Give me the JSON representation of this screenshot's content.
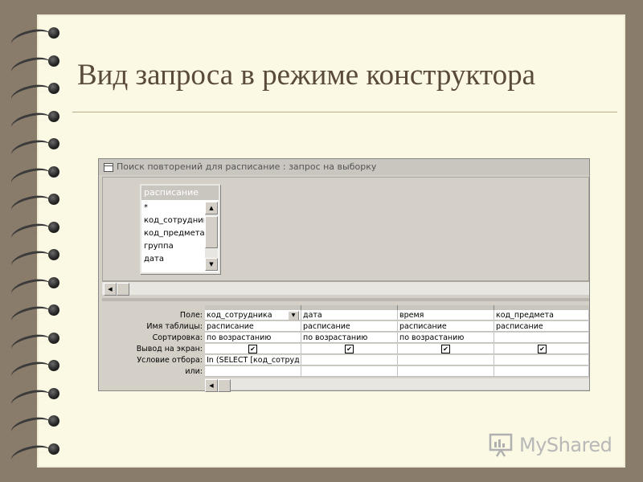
{
  "slide": {
    "title": "Вид запроса в режиме конструктора"
  },
  "window": {
    "title": "Поиск повторений для расписание : запрос на выборку"
  },
  "field_list": {
    "table_name": "расписание",
    "items": [
      "*",
      "код_сотрудник",
      "код_предмета",
      "группа",
      "дата"
    ]
  },
  "grid": {
    "row_labels": {
      "field": "Поле:",
      "table": "Имя таблицы:",
      "sort": "Сортировка:",
      "show": "Вывод на экран:",
      "criteria": "Условие отбора:",
      "or": "или:"
    },
    "columns": [
      {
        "field": "код_сотрудника",
        "table": "расписание",
        "sort": "по возрастанию",
        "show": true,
        "criteria": "In (SELECT [код_сотруд",
        "or": ""
      },
      {
        "field": "дата",
        "table": "расписание",
        "sort": "по возрастанию",
        "show": true,
        "criteria": "",
        "or": ""
      },
      {
        "field": "время",
        "table": "расписание",
        "sort": "по возрастанию",
        "show": true,
        "criteria": "",
        "or": ""
      },
      {
        "field": "код_предмета",
        "table": "расписание",
        "sort": "",
        "show": true,
        "criteria": "",
        "or": ""
      }
    ]
  },
  "icons": {
    "app": "query-window-icon",
    "scroll_up": "scroll-up-icon",
    "scroll_down": "scroll-down-icon",
    "scroll_left": "scroll-left-icon",
    "dropdown": "chevron-down-icon",
    "checkbox": "checkbox-checked-icon",
    "logo": "presentation-board-icon"
  },
  "watermark": {
    "text": "MyShared"
  },
  "colors": {
    "background": "#8a7c6a",
    "paper": "#fbf8e4",
    "title_text": "#5a4a3a",
    "window_face": "#d4d0c8"
  }
}
